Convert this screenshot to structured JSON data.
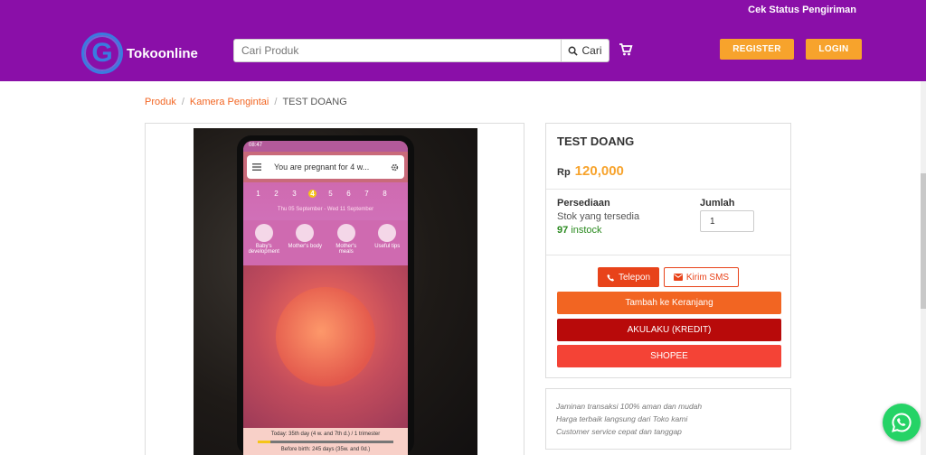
{
  "header": {
    "track_link": "Cek Status Pengiriman",
    "logo_text": "Tokoonline",
    "logo_letter": "G",
    "search_placeholder": "Cari Produk",
    "search_button": "Cari",
    "register": "REGISTER",
    "login": "LOGIN",
    "colors": {
      "bar": "#8a0fa8",
      "button": "#f7a32c"
    }
  },
  "breadcrumb": {
    "items": [
      "Produk",
      "Kamera Pengintai"
    ],
    "current": "TEST DOANG",
    "separator": "/"
  },
  "image": {
    "screen_title": "You are pregnant for 4 w...",
    "status_time": "08:47",
    "days": [
      "1",
      "2",
      "3",
      "4",
      "5",
      "6",
      "7",
      "8"
    ],
    "selected_day": "4",
    "date_range": "Thu 05 September - Wed 11 September",
    "categories": [
      "Baby's development",
      "Mother's body",
      "Mother's meals",
      "Useful tips"
    ],
    "today_line": "Today: 35th day (4 w. and 7th d.) / 1 trimester",
    "birth_line": "Before birth: 245 days (35w. and 0d.)"
  },
  "product": {
    "title": "TEST DOANG",
    "currency": "Rp",
    "price": "120,000",
    "stock_label": "Persediaan",
    "stock_sub": "Stok yang tersedia",
    "stock_count": "97",
    "stock_suffix": "instock",
    "qty_label": "Jumlah",
    "qty_value": "1",
    "btn_phone": "Telepon",
    "btn_sms": "Kirim SMS",
    "btn_cart": "Tambah ke Keranjang",
    "btn_akulaku": "AKULAKU (KREDIT)",
    "btn_shopee": "SHOPEE",
    "colors": {
      "price": "#f7a32c",
      "cart": "#f26522",
      "akulaku": "#b80a0a",
      "shopee": "#f44336",
      "stock": "#2a8a1f"
    }
  },
  "guarantee": {
    "lines": [
      "Jaminan transaksi 100% aman dan mudah",
      "Harga terbaik langsung dari Toko kami",
      "Customer service cepat dan tanggap"
    ]
  },
  "icons": [
    "search-icon",
    "cart-icon",
    "phone-icon",
    "mail-icon",
    "whatsapp-icon",
    "menu-icon",
    "settings-icon"
  ]
}
